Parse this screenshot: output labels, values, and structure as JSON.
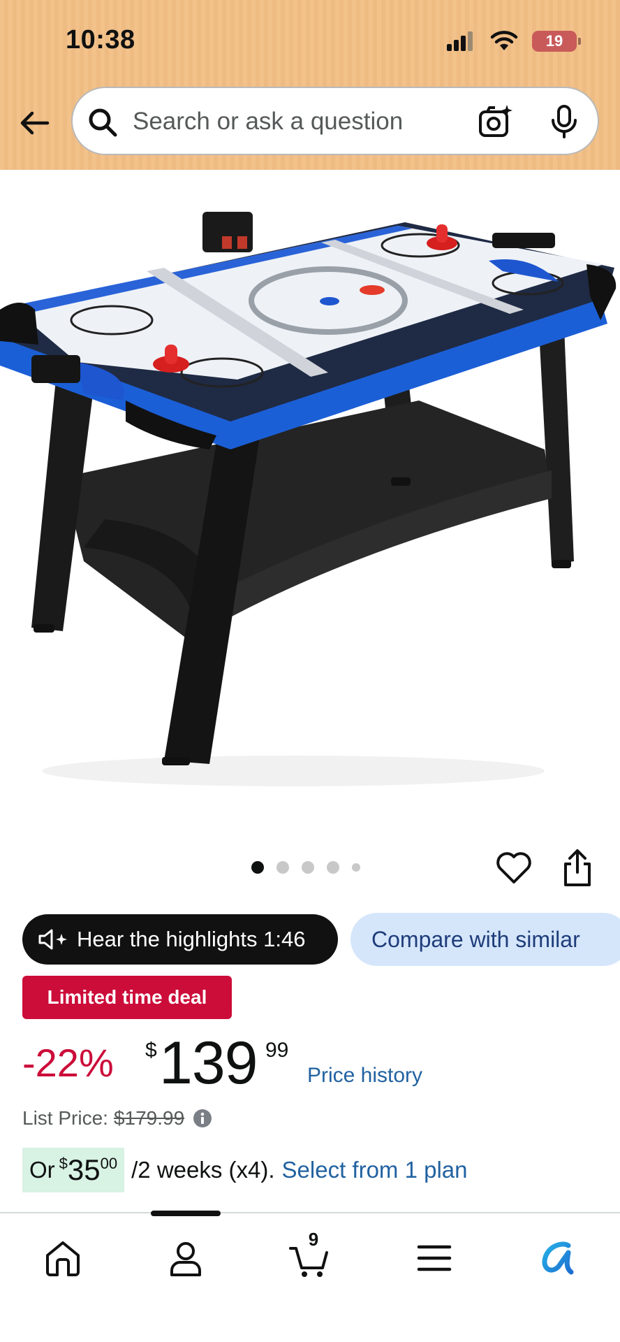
{
  "status_bar": {
    "time": "10:38",
    "battery_level": "19",
    "battery_color": "#c95a5a"
  },
  "header": {
    "background_color": "#f2c28a",
    "search": {
      "placeholder": "Search or ask a question"
    },
    "icons": [
      "back-arrow-icon",
      "search-icon",
      "camera-sparkle-icon",
      "microphone-icon"
    ]
  },
  "product": {
    "image": "air-hockey-table",
    "carousel": {
      "dot_count": 5,
      "active_index": 0
    },
    "actions": [
      "heart-icon",
      "share-icon"
    ]
  },
  "pills": {
    "hear_highlights": "Hear the highlights 1:46",
    "compare": "Compare with similar"
  },
  "deal_badge": "Limited time deal",
  "price": {
    "discount": "-22%",
    "currency": "$",
    "whole": "139",
    "fraction": "99",
    "history_link": "Price history",
    "list_price_label": "List Price:",
    "list_price": "$179.99"
  },
  "installment": {
    "prefix": "Or",
    "currency": "$",
    "whole": "35",
    "fraction": "00",
    "period": "/2 weeks (x4).",
    "link": "Select from 1 plan"
  },
  "bottom_nav": {
    "cart_count": "9",
    "items": [
      "home-icon",
      "account-icon",
      "cart-icon",
      "menu-icon",
      "rufus-icon"
    ]
  },
  "colors": {
    "deal_red": "#cc0c39",
    "link_blue": "#2162a1",
    "compare_bg": "#d5e6fb",
    "installment_bg": "#d8f2e4"
  }
}
